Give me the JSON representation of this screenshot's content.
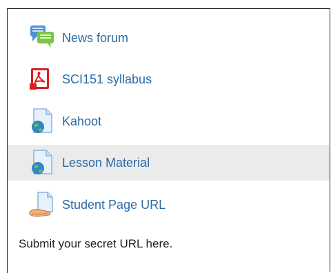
{
  "activities": [
    {
      "label": "News forum",
      "icon": "forum-icon"
    },
    {
      "label": "SCI151 syllabus",
      "icon": "pdf-icon"
    },
    {
      "label": "Kahoot",
      "icon": "url-icon"
    },
    {
      "label": "Lesson Material",
      "icon": "url-icon",
      "highlighted": true
    },
    {
      "label": "Student Page URL",
      "icon": "assignment-icon"
    }
  ],
  "note": "Submit your secret URL here.",
  "colors": {
    "link": "#2a6aa6",
    "highlight": "#ebebeb",
    "border": "#1f1f1f"
  }
}
